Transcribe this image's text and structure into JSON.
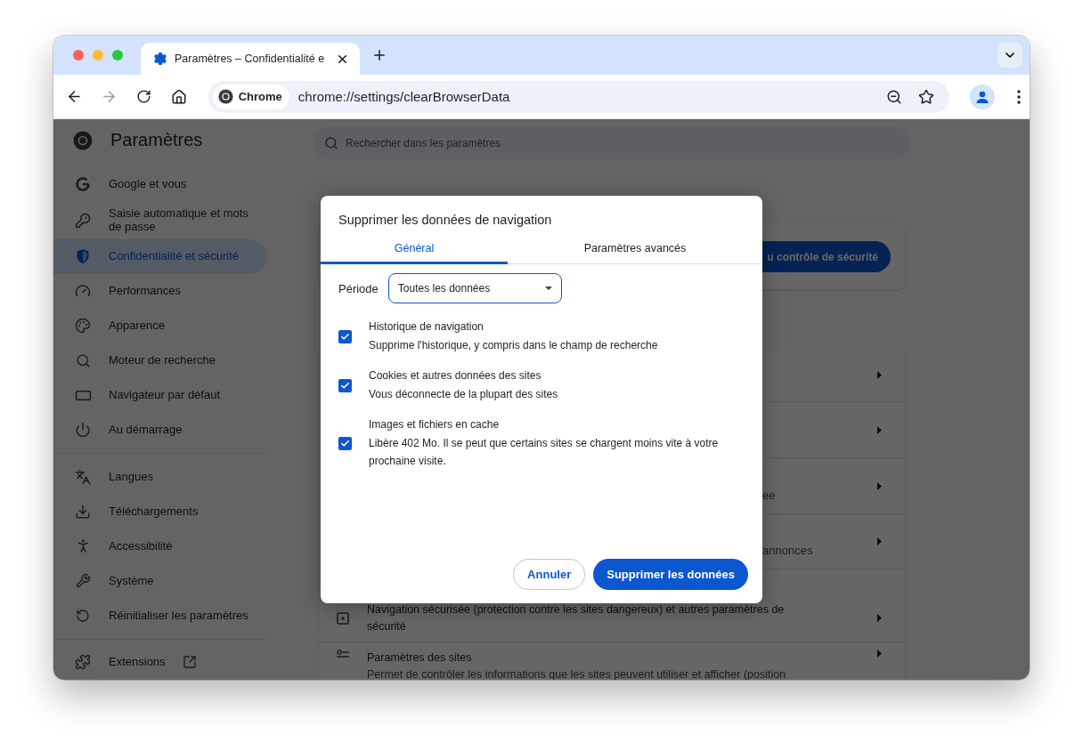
{
  "tabs": [
    {
      "title": "Paramètres – Confidentialité e",
      "selected": true
    }
  ],
  "toolbar": {
    "forward_button": {
      "disabled": true
    },
    "omnibox": {
      "chip": "Chrome",
      "url": "chrome://settings/clearBrowserData"
    }
  },
  "settings": {
    "title": "Paramètres",
    "search": {
      "placeholder": "Rechercher dans les paramètres"
    },
    "sidebar": {
      "groups": [
        [
          {
            "label": "Google et vous",
            "selected": false
          },
          {
            "label": "Saisie automatique et mots de passe",
            "selected": false
          },
          {
            "label": "Confidentialité et sécurité",
            "selected": true
          },
          {
            "label": "Performances",
            "selected": false
          },
          {
            "label": "Apparence",
            "selected": false
          },
          {
            "label": "Moteur de recherche",
            "selected": false
          },
          {
            "label": "Navigateur par défaut",
            "selected": false
          },
          {
            "label": "Au démarrage",
            "selected": false
          }
        ],
        [
          {
            "label": "Langues",
            "selected": false
          },
          {
            "label": "Téléchargements",
            "selected": false
          },
          {
            "label": "Accessibilité",
            "selected": false
          },
          {
            "label": "Système",
            "selected": false
          },
          {
            "label": "Réinitialiser les paramètres",
            "selected": false
          }
        ],
        [
          {
            "label": "Extensions",
            "selected": false
          }
        ]
      ]
    },
    "main": {
      "safety_button": "u contrôle de sécurité",
      "rows": [
        {
          "kind": "empty"
        },
        {
          "kind": "empty"
        },
        {
          "kind": "partial",
          "text": "ee"
        },
        {
          "kind": "partial",
          "text": "annonces"
        },
        {
          "kind": "full",
          "title": "Navigation sécurisée (protection contre les sites dangereux) et autres paramètres de sécurité"
        },
        {
          "kind": "full",
          "title": "Paramètres des sites",
          "description": "Permet de contrôler les informations que les sites peuvent utiliser et afficher (position"
        }
      ]
    }
  },
  "dialog": {
    "title": "Supprimer les données de navigation",
    "tabs": [
      {
        "label": "Général",
        "selected": true
      },
      {
        "label": "Paramètres avancés",
        "selected": false
      }
    ],
    "period": {
      "label": "Période",
      "value": "Toutes les données"
    },
    "items": [
      {
        "title": "Historique de navigation",
        "description": "Supprime l'historique, y compris dans le champ de recherche",
        "checked": true
      },
      {
        "title": "Cookies et autres données des sites",
        "description": "Vous déconnecte de la plupart des sites",
        "checked": true
      },
      {
        "title": "Images et fichiers en cache",
        "description": "Libère 402 Mo. Il se peut que certains sites se chargent moins vite à votre prochaine visite.",
        "checked": true
      }
    ],
    "buttons": {
      "cancel": "Annuler",
      "confirm": "Supprimer les données"
    }
  }
}
